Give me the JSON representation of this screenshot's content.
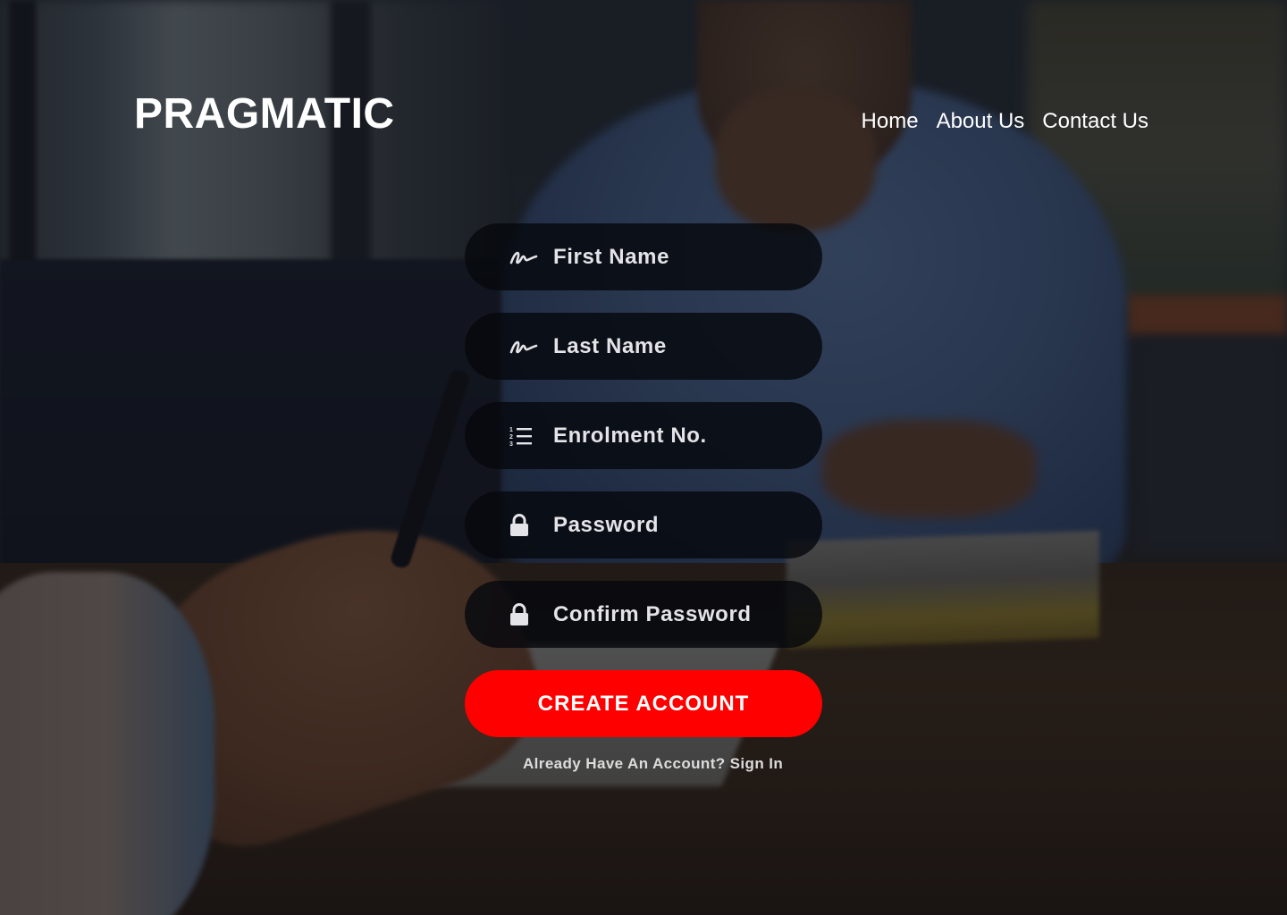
{
  "brand": {
    "name": "PRAGMATIC"
  },
  "nav": {
    "items": [
      {
        "label": "Home"
      },
      {
        "label": "About Us"
      },
      {
        "label": "Contact Us"
      }
    ]
  },
  "form": {
    "fields": [
      {
        "label": "First Name",
        "icon": "signature-icon"
      },
      {
        "label": "Last Name",
        "icon": "signature-icon"
      },
      {
        "label": "Enrolment No.",
        "icon": "numbered-list-icon"
      },
      {
        "label": "Password",
        "icon": "lock-icon"
      },
      {
        "label": "Confirm Password",
        "icon": "lock-icon"
      }
    ],
    "submit_label": "CREATE ACCOUNT",
    "signin_text": "Already Have An Account? Sign In"
  },
  "colors": {
    "accent": "#ff0000",
    "field_bg": "#06080e",
    "text": "#ffffff"
  }
}
